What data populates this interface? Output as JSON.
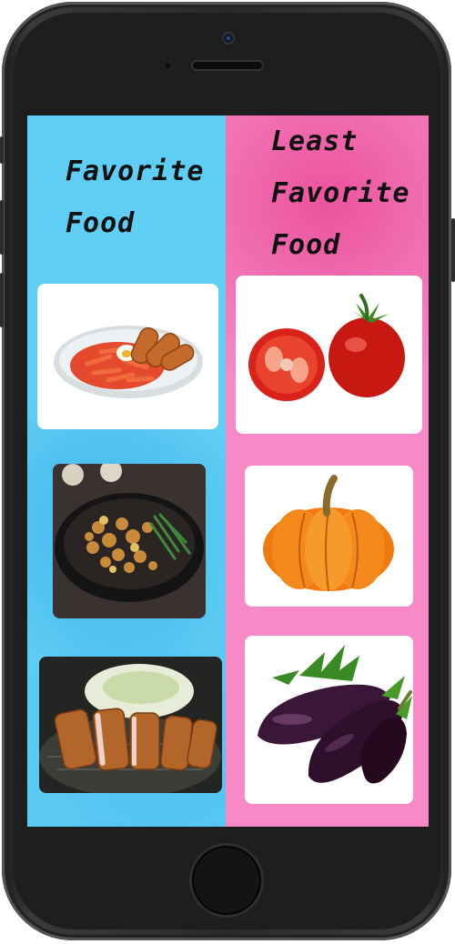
{
  "screen": {
    "left_panel": {
      "title_line1": "Favorite",
      "title_line2": "Food",
      "color": "#5fcef4",
      "items": [
        {
          "icon": "tteokbokki-plate-icon"
        },
        {
          "icon": "grilled-pork-pan-icon"
        },
        {
          "icon": "tonkatsu-cutlet-icon"
        }
      ]
    },
    "right_panel": {
      "title_line1": "Least",
      "title_line2": "Favorite",
      "title_line3": "Food",
      "color": "#f78ac6",
      "items": [
        {
          "icon": "tomato-icon"
        },
        {
          "icon": "pumpkin-icon"
        },
        {
          "icon": "eggplant-icon"
        }
      ]
    }
  }
}
